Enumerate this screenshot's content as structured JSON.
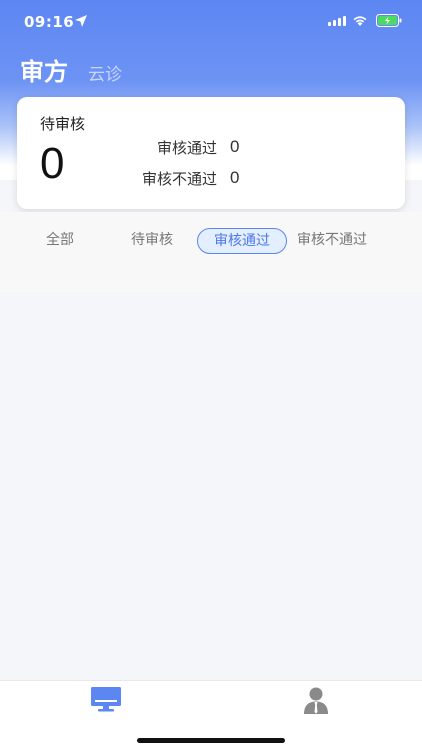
{
  "status": {
    "time": "09:16"
  },
  "header": {
    "title": "审方",
    "subtitle": "云诊"
  },
  "summary": {
    "pending_label": "待审核",
    "pending_count": "0",
    "approved_label": "审核通过",
    "approved_count": "0",
    "rejected_label": "审核不通过",
    "rejected_count": "0"
  },
  "tabs": [
    {
      "label": "全部",
      "active": false
    },
    {
      "label": "待审核",
      "active": false
    },
    {
      "label": "审核通过",
      "active": true
    },
    {
      "label": "审核不通过",
      "active": false
    }
  ],
  "tabbar": {
    "items": [
      {
        "icon": "monitor-icon",
        "active": true
      },
      {
        "icon": "user-icon",
        "active": false
      }
    ]
  },
  "colors": {
    "accent": "#5c86f2",
    "tab_active_bg": "#e3eefe",
    "tab_active_text": "#4d77e8",
    "battery_green": "#4cd964"
  }
}
